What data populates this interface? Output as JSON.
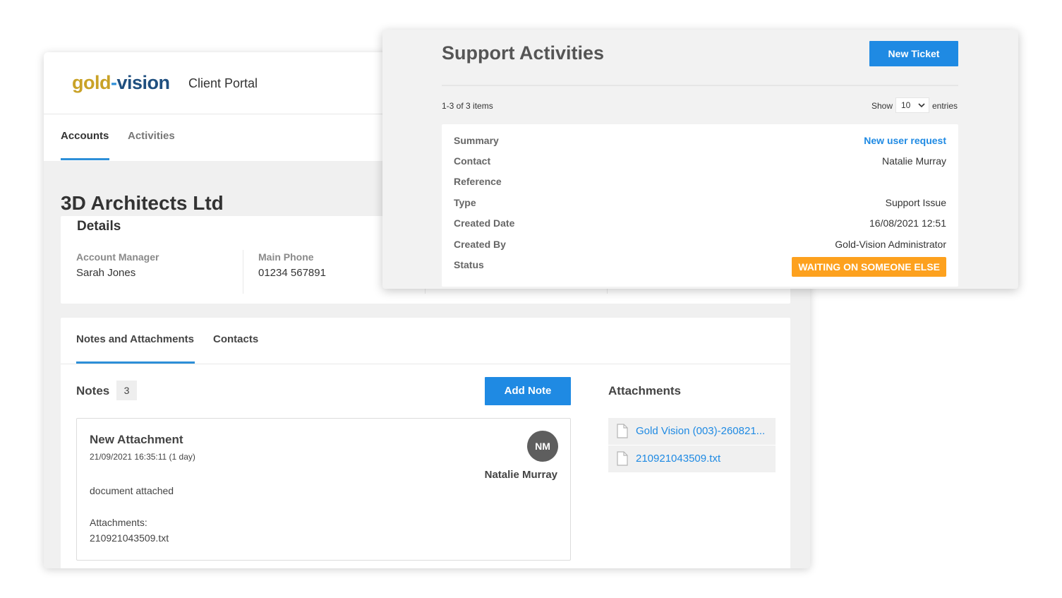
{
  "portal": {
    "logo": {
      "part1": "gold",
      "dash": "-",
      "part2": "vision"
    },
    "title": "Client Portal",
    "nav": [
      {
        "label": "Accounts",
        "active": true
      },
      {
        "label": "Activities",
        "active": false
      }
    ],
    "account_name": "3D Architects Ltd",
    "details": {
      "heading": "Details",
      "fields": [
        {
          "label": "Account Manager",
          "value": "Sarah Jones"
        },
        {
          "label": "Main Phone",
          "value": "01234 567891"
        }
      ]
    },
    "sub_tabs": [
      {
        "label": "Notes and Attachments",
        "active": true
      },
      {
        "label": "Contacts",
        "active": false
      }
    ],
    "notes": {
      "title": "Notes",
      "count": "3",
      "add_label": "Add Note",
      "items": [
        {
          "title": "New Attachment",
          "date": "21/09/2021 16:35:11 (1 day)",
          "avatar_initials": "NM",
          "author": "Natalie Murray",
          "text": "document attached",
          "attachments_label": "Attachments:",
          "attachment_file": "210921043509.txt"
        }
      ]
    },
    "attachments": {
      "title": "Attachments",
      "items": [
        {
          "name": "Gold Vision (003)-260821...",
          "icon": "file-icon"
        },
        {
          "name": "210921043509.txt",
          "icon": "file-icon"
        }
      ]
    }
  },
  "support": {
    "title": "Support Activities",
    "new_ticket_label": "New Ticket",
    "items_count": "1-3 of 3 items",
    "show_label": "Show",
    "entries_value": "10",
    "entries_label": "entries",
    "ticket": {
      "fields": [
        {
          "label": "Summary",
          "value": "New user request",
          "link": true
        },
        {
          "label": "Contact",
          "value": "Natalie Murray"
        },
        {
          "label": "Reference",
          "value": ""
        },
        {
          "label": "Type",
          "value": "Support Issue"
        },
        {
          "label": "Created Date",
          "value": "16/08/2021 12:51"
        },
        {
          "label": "Created By",
          "value": "Gold-Vision Administrator"
        }
      ],
      "status_label": "Status",
      "status_value": "WAITING ON SOMEONE ELSE"
    }
  },
  "colors": {
    "accent_blue": "#1f8ae3",
    "status_orange": "#fda11e",
    "logo_gold": "#c9a227",
    "logo_navy": "#1f4f7f"
  }
}
